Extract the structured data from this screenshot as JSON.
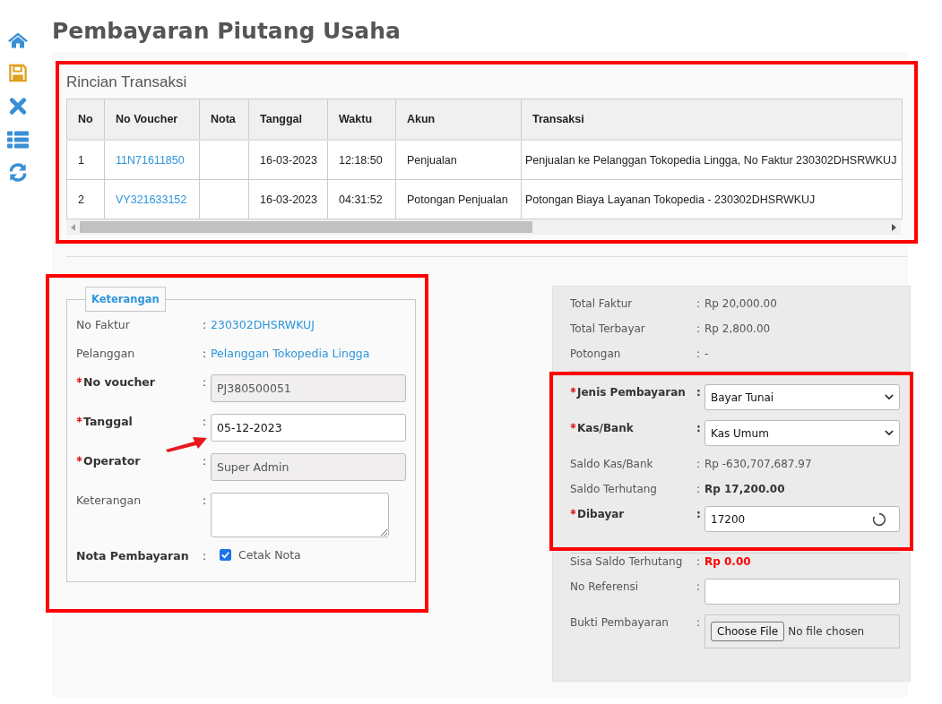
{
  "page_title": "Pembayaran Piutang Usaha",
  "transactions": {
    "title": "Rincian Transaksi",
    "columns": [
      "No",
      "No Voucher",
      "Nota",
      "Tanggal",
      "Waktu",
      "Akun",
      "Transaksi"
    ],
    "rows": [
      {
        "no": "1",
        "voucher": "11N71611850",
        "date": "16-03-2023",
        "time": "12:18:50",
        "account": "Penjualan",
        "description": "Penjualan ke Pelanggan Tokopedia Lingga, No Faktur 230302DHSRWKUJ"
      },
      {
        "no": "2",
        "voucher": "VY321633152",
        "date": "16-03-2023",
        "time": "04:31:52",
        "account": "Potongan Penjualan",
        "description": "Potongan Biaya Layanan Tokopedia - 230302DHSRWKUJ"
      }
    ]
  },
  "details": {
    "legend": "Keterangan",
    "fields": [
      {
        "kind": "link",
        "label": "No Faktur",
        "required": false,
        "separator": ":",
        "value": "230302DHSRWKUJ"
      },
      {
        "kind": "link",
        "label": "Pelanggan",
        "required": false,
        "separator": ":",
        "value": "Pelanggan Tokopedia Lingga"
      },
      {
        "kind": "input",
        "label": "No voucher",
        "required": true,
        "separator": ":",
        "disabled": true,
        "value": "PJ380500051"
      },
      {
        "kind": "input",
        "label": "Tanggal",
        "required": true,
        "separator": ":",
        "disabled": false,
        "value": "05-12-2023"
      },
      {
        "kind": "input",
        "label": "Operator",
        "required": true,
        "separator": ":",
        "disabled": true,
        "value": "Super Admin"
      },
      {
        "kind": "textarea",
        "label": "Keterangan",
        "required": false,
        "separator": ":"
      },
      {
        "kind": "checkbox",
        "label": "Nota Pembayaran",
        "required": false,
        "separator": ":",
        "option": "Cetak Nota",
        "checked": true
      }
    ]
  },
  "summary": [
    {
      "label": "Total Faktur",
      "separator": ":",
      "value": "Rp 20,000.00"
    },
    {
      "label": "Total Terbayar",
      "separator": ":",
      "value": "Rp 2,800.00"
    },
    {
      "label": "Potongan",
      "separator": ":",
      "value": "-"
    }
  ],
  "payment": [
    {
      "kind": "select",
      "label": "Jenis Pembayaran",
      "required": true,
      "separator": ":",
      "value": "Bayar Tunai"
    },
    {
      "kind": "select",
      "label": "Kas/Bank",
      "required": true,
      "separator": ":",
      "value": "Kas Umum"
    },
    {
      "kind": "text",
      "label": "Saldo Kas/Bank",
      "required": false,
      "separator": ":",
      "value": "Rp -630,707,687.97"
    },
    {
      "kind": "bold",
      "label": "Saldo Terhutang",
      "required": false,
      "separator": ":",
      "value": "Rp 17,200.00"
    },
    {
      "kind": "input",
      "label": "Dibayar",
      "required": true,
      "separator": ":",
      "value": "17200",
      "loading": true
    }
  ],
  "extra": [
    {
      "kind": "alert",
      "label": "Sisa Saldo Terhutang",
      "separator": ":",
      "value": "Rp 0.00"
    },
    {
      "kind": "input",
      "label": "No Referensi",
      "separator": ":"
    },
    {
      "kind": "file",
      "label": "Bukti Pembayaran",
      "separator": ":",
      "button": "Choose File",
      "status": "No file chosen"
    }
  ]
}
